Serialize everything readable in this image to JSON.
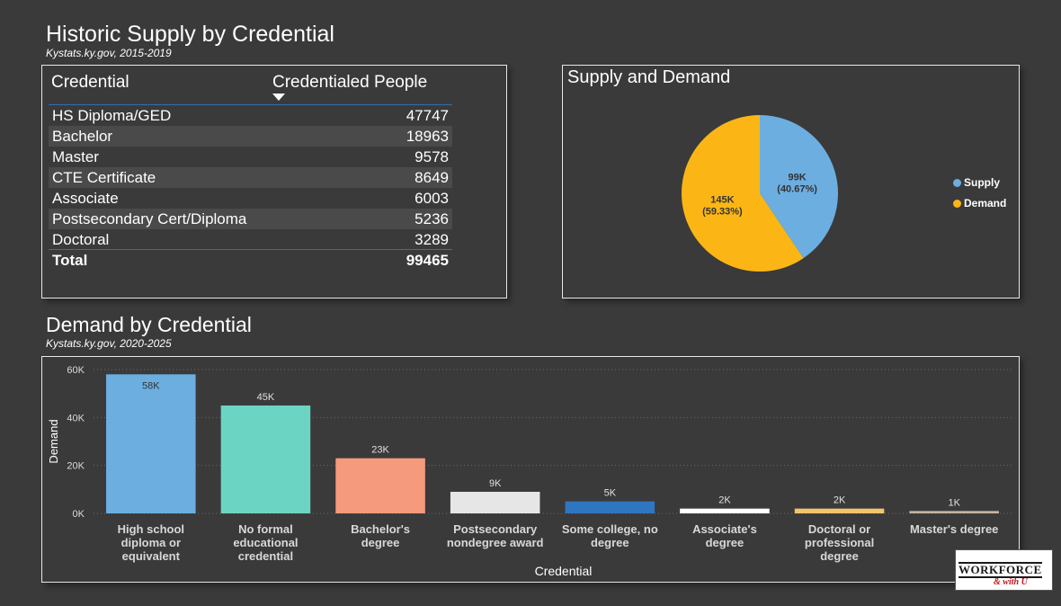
{
  "header1": {
    "title": "Historic Supply by Credential",
    "subtitle": "Kystats.ky.gov, 2015-2019"
  },
  "supply_table": {
    "col1": "Credential",
    "col2": "Credentialed People",
    "rows": [
      {
        "credential": "HS Diploma/GED",
        "people": "47747"
      },
      {
        "credential": "Bachelor",
        "people": "18963"
      },
      {
        "credential": "Master",
        "people": "9578"
      },
      {
        "credential": "CTE Certificate",
        "people": "8649"
      },
      {
        "credential": "Associate",
        "people": "6003"
      },
      {
        "credential": "Postsecondary Cert/Diploma",
        "people": "5236"
      },
      {
        "credential": "Doctoral",
        "people": "3289"
      }
    ],
    "total_label": "Total",
    "total_value": "99465"
  },
  "header2": {
    "title": "Demand by Credential",
    "subtitle": "Kystats.ky.gov, 2020-2025"
  },
  "logo": {
    "line1": "WORKFORCE",
    "line2": "& with U"
  },
  "chart_data": [
    {
      "type": "pie",
      "title": "Supply and Demand",
      "slices": [
        {
          "name": "Supply",
          "value": 99,
          "label": "99K",
          "pct": "(40.67%)",
          "color": "#6caee0"
        },
        {
          "name": "Demand",
          "value": 145,
          "label": "145K",
          "pct": "(59.33%)",
          "color": "#fbb616"
        }
      ],
      "legend": "right"
    },
    {
      "type": "bar",
      "categories": [
        [
          "High school",
          "diploma or",
          "equivalent"
        ],
        [
          "No formal",
          "educational",
          "credential"
        ],
        [
          "Bachelor's",
          "degree"
        ],
        [
          "Postsecondary",
          "nondegree award"
        ],
        [
          "Some college, no",
          "degree"
        ],
        [
          "Associate's",
          "degree"
        ],
        [
          "Doctoral or",
          "professional",
          "degree"
        ],
        [
          "Master's degree"
        ]
      ],
      "values": [
        58,
        45,
        23,
        9,
        5,
        2,
        2,
        1
      ],
      "value_labels": [
        "58K",
        "45K",
        "23K",
        "9K",
        "5K",
        "2K",
        "2K",
        "1K"
      ],
      "colors": [
        "#6caee0",
        "#6cd4c2",
        "#f59a7c",
        "#e6e6e6",
        "#2e76c0",
        "#ffffff",
        "#f4c46a",
        "#c4b4a2"
      ],
      "xlabel": "Credential",
      "ylabel": "Demand",
      "ylim": [
        0,
        60
      ],
      "yticks": [
        0,
        20,
        40,
        60
      ],
      "ytick_labels": [
        "0K",
        "20K",
        "40K",
        "60K"
      ],
      "grid": true
    }
  ]
}
